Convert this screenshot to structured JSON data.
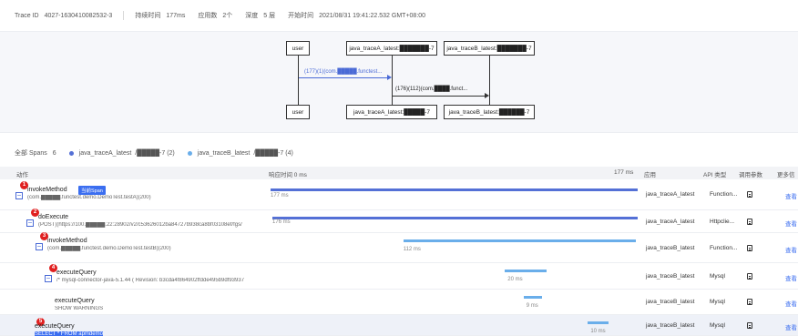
{
  "header": {
    "trace_id_label": "Trace ID",
    "trace_id_value": "4027-1630410082532-3",
    "duration_label": "持续时间",
    "duration_value": "177ms",
    "app_count_label": "应用数",
    "app_count_value": "2个",
    "depth_label": "深度",
    "depth_value": "5 层",
    "start_label": "开始时间",
    "start_value": "2021/08/31 19:41:22.532 GMT+08:00"
  },
  "sequence": {
    "actors_top": [
      "user",
      "java_traceA_latest:███████-7",
      "java_traceB_latest:███████-7"
    ],
    "actors_bottom": [
      "user",
      "java_traceA_latest:█████-7",
      "java_traceB_latest:██████-7"
    ],
    "messages": [
      {
        "label": "(177)(1)(com.█████.functest..."
      },
      {
        "label": "(176)(112)(com.████.funct..."
      }
    ]
  },
  "summary": {
    "all_spans": "全部 Spans",
    "all_spans_count": "6",
    "app_a": "java_traceA_latest",
    "app_a_suffix": "/█████-7 (2)",
    "app_b": "java_traceB_latest",
    "app_b_suffix": "/█████-7 (4)"
  },
  "table": {
    "columns": {
      "action": "动作",
      "response_time": "响应时间 0 ms",
      "end_time": "177 ms",
      "app": "应用",
      "api_type": "API 类型",
      "params": "调用参数",
      "more": "更多信"
    },
    "current_span_tag": "当前Span",
    "view_label": "查看",
    "rows": [
      {
        "badge": "1",
        "name": "invokeMethod",
        "sub": "(com.█████.functest.demo.DemoTest.testA)(200)",
        "duration_text": "177 ms",
        "duration": 177,
        "start": 0,
        "app": "java_traceA_latest",
        "api": "Function...",
        "highlight": false
      },
      {
        "badge": "2",
        "name": "doExecute",
        "sub": "(POST)(https://100.█████.22:28902/v2/c53626012ba84727b938ca8bf03108ef/fgs/",
        "duration_text": "176 ms",
        "duration": 176,
        "start": 1,
        "app": "java_traceA_latest",
        "api": "Httpclie...",
        "highlight": false
      },
      {
        "badge": "3",
        "name": "invokeMethod",
        "sub": "(com.█████.functest.demo.DemoTest.testB)(200)",
        "duration_text": "112 ms",
        "duration": 112,
        "start": 64,
        "app": "java_traceB_latest",
        "api": "Function...",
        "highlight": false
      },
      {
        "badge": "4",
        "name": "executeQuery",
        "sub": "/* mysql-connector-java-5.1.44 ( Revision: b3cda4f864902ffdde495b9df93937",
        "duration_text": "20 ms",
        "duration": 20,
        "start": 113,
        "app": "java_traceB_latest",
        "api": "Mysql",
        "highlight": false
      },
      {
        "badge": "",
        "name": "executeQuery",
        "sub": "SHOW WARNINGS",
        "duration_text": "9 ms",
        "duration": 9,
        "start": 122,
        "app": "java_traceB_latest",
        "api": "Mysql",
        "highlight": false
      },
      {
        "badge": "5",
        "name": "executeQuery",
        "sub": "SELECT * FROM apmdemo",
        "duration_text": "10 ms",
        "duration": 10,
        "start": 153,
        "app": "java_traceB_latest",
        "api": "Mysql",
        "highlight": true
      }
    ]
  },
  "colors": {
    "bar_a": "#5470d6",
    "bar_b": "#6aaeea",
    "badge": "#e02020",
    "link": "#3b6ef0",
    "message": "#4a6ad6"
  }
}
